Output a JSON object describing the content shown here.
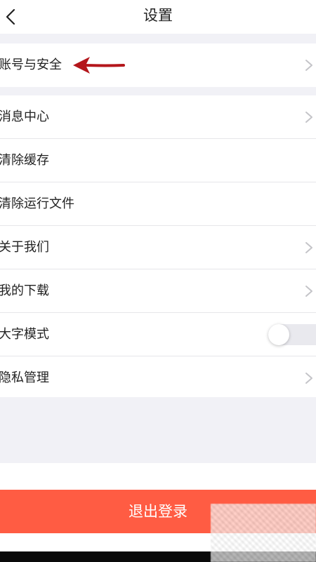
{
  "header": {
    "title": "设置",
    "back_icon": "chevron-left-icon"
  },
  "group1": [
    {
      "label": "账号与安全",
      "has_chevron": true
    }
  ],
  "group2": [
    {
      "label": "消息中心",
      "has_chevron": true
    },
    {
      "label": "清除缓存",
      "has_chevron": false
    },
    {
      "label": "清除运行文件",
      "has_chevron": false
    },
    {
      "label": "关于我们",
      "has_chevron": true
    },
    {
      "label": "我的下载",
      "has_chevron": true
    },
    {
      "label": "大字模式",
      "has_toggle": true,
      "toggle_on": false
    },
    {
      "label": "隐私管理",
      "has_chevron": true
    }
  ],
  "logout": {
    "label": "退出登录"
  },
  "colors": {
    "accent": "#ff5c43",
    "annotation_arrow": "#b4161b",
    "background": "#f1f1f6"
  }
}
